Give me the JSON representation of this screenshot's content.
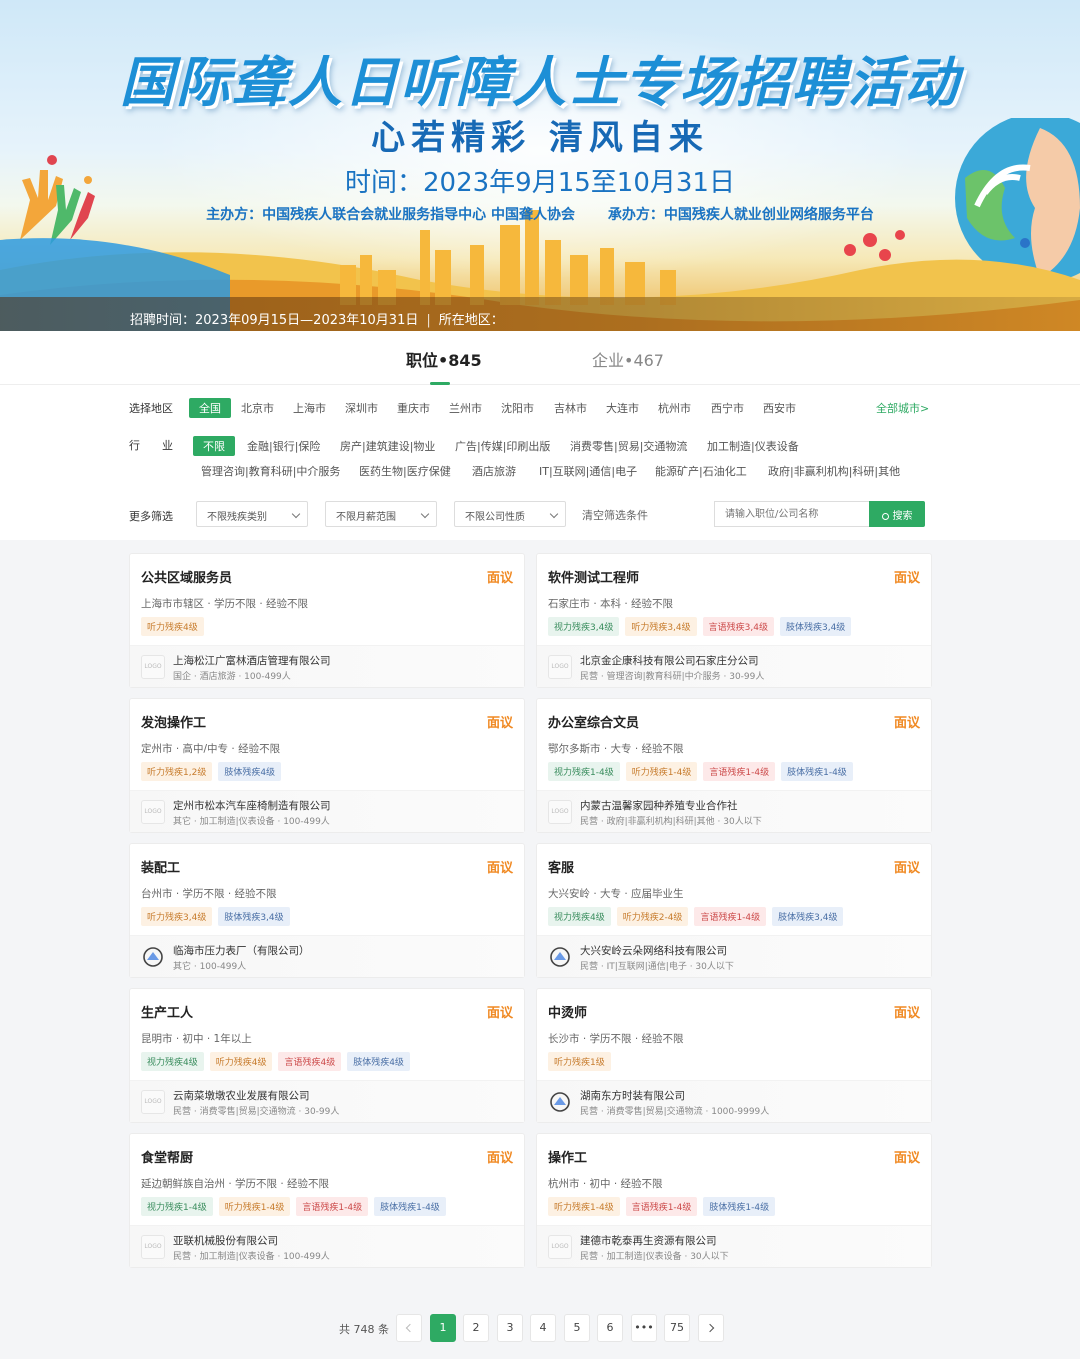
{
  "banner": {
    "title": "国际聋人日听障人士专场招聘活动",
    "slogan": "心若精彩   清风自来",
    "time": "时间：2023年9月15至10月31日",
    "organizer": "主办方：中国残疾人联合会就业服务指导中心  中国聋人协会",
    "undertaker": "承办方：中国残疾人就业创业网络服务平台",
    "recruit_time": "招聘时间：2023年09月15日—2023年10月31日",
    "region_label": "所在地区："
  },
  "tabs": [
    {
      "label": "职位•845"
    },
    {
      "label": "企业•467"
    }
  ],
  "filters": {
    "region_label": "选择地区",
    "regions": [
      "全国",
      "北京市",
      "上海市",
      "深圳市",
      "重庆市",
      "兰州市",
      "沈阳市",
      "吉林市",
      "大连市",
      "杭州市",
      "西宁市",
      "西安市"
    ],
    "all_cities": "全部城市>",
    "industry_label": "行　　业",
    "industries_row1": [
      "不限",
      "金融|银行|保险",
      "房产|建筑建设|物业",
      "广告|传媒|印刷出版",
      "消费零售|贸易|交通物流",
      "加工制造|仪表设备"
    ],
    "industries_row2": [
      "管理咨询|教育科研|中介服务",
      "医药生物|医疗保健",
      "酒店旅游",
      "IT|互联网|通信|电子",
      "能源矿产|石油化工",
      "政府|非赢利机构|科研|其他"
    ],
    "more_label": "更多筛选",
    "select_disability": "不限残疾类别",
    "select_salary": "不限月薪范围",
    "select_company": "不限公司性质",
    "clear": "清空筛选条件",
    "search_placeholder": "请输入职位/公司名称",
    "search_button": "搜索"
  },
  "jobs": [
    {
      "title": "公共区域服务员",
      "salary": "面议",
      "meta": "上海市市辖区 · 学历不限 · 经验不限",
      "tags": [
        {
          "type": "hearing",
          "text": "听力残疾4级"
        }
      ],
      "company": "上海松江广富林酒店管理有限公司",
      "company_info": "国企 · 酒店旅游 · 100-499人",
      "logo": "LOGO"
    },
    {
      "title": "软件测试工程师",
      "salary": "面议",
      "meta": "石家庄市 · 本科 · 经验不限",
      "tags": [
        {
          "type": "vision",
          "text": "视力残疾3,4级"
        },
        {
          "type": "hearing",
          "text": "听力残疾3,4级"
        },
        {
          "type": "speech",
          "text": "言语残疾3,4级"
        },
        {
          "type": "limb",
          "text": "肢体残疾3,4级"
        }
      ],
      "company": "北京金企康科技有限公司石家庄分公司",
      "company_info": "民营 · 管理咨询|教育科研|中介服务 · 30-99人",
      "logo": "LOGO"
    },
    {
      "title": "发泡操作工",
      "salary": "面议",
      "meta": "定州市 · 高中/中专 · 经验不限",
      "tags": [
        {
          "type": "hearing",
          "text": "听力残疾1,2级"
        },
        {
          "type": "limb",
          "text": "肢体残疾4级"
        }
      ],
      "company": "定州市松本汽车座椅制造有限公司",
      "company_info": "其它 · 加工制造|仪表设备 · 100-499人",
      "logo": "LOGO"
    },
    {
      "title": "办公室综合文员",
      "salary": "面议",
      "meta": "鄂尔多斯市 · 大专 · 经验不限",
      "tags": [
        {
          "type": "vision",
          "text": "视力残疾1-4级"
        },
        {
          "type": "hearing",
          "text": "听力残疾1-4级"
        },
        {
          "type": "speech",
          "text": "言语残疾1-4级"
        },
        {
          "type": "limb",
          "text": "肢体残疾1-4级"
        }
      ],
      "company": "内蒙古温馨家园种养殖专业合作社",
      "company_info": "民营 · 政府|非赢利机构|科研|其他 · 30人以下",
      "logo": "LOGO"
    },
    {
      "title": "装配工",
      "salary": "面议",
      "meta": "台州市 · 学历不限 · 经验不限",
      "tags": [
        {
          "type": "hearing",
          "text": "听力残疾3,4级"
        },
        {
          "type": "limb",
          "text": "肢体残疾3,4级"
        }
      ],
      "company": "临海市压力表厂（有限公司）",
      "company_info": "其它 · 100-499人",
      "logo": ""
    },
    {
      "title": "客服",
      "salary": "面议",
      "meta": "大兴安岭 · 大专 · 应届毕业生",
      "tags": [
        {
          "type": "vision",
          "text": "视力残疾4级"
        },
        {
          "type": "hearing",
          "text": "听力残疾2-4级"
        },
        {
          "type": "speech",
          "text": "言语残疾1-4级"
        },
        {
          "type": "limb",
          "text": "肢体残疾3,4级"
        }
      ],
      "company": "大兴安岭云朵网络科技有限公司",
      "company_info": "民营 · IT|互联网|通信|电子 · 30人以下",
      "logo": ""
    },
    {
      "title": "生产工人",
      "salary": "面议",
      "meta": "昆明市 · 初中 · 1年以上",
      "tags": [
        {
          "type": "vision",
          "text": "视力残疾4级"
        },
        {
          "type": "hearing",
          "text": "听力残疾4级"
        },
        {
          "type": "speech",
          "text": "言语残疾4级"
        },
        {
          "type": "limb",
          "text": "肢体残疾4级"
        }
      ],
      "company": "云南菜墩墩农业发展有限公司",
      "company_info": "民营 · 消费零售|贸易|交通物流 · 30-99人",
      "logo": "LOGO"
    },
    {
      "title": "中烫师",
      "salary": "面议",
      "meta": "长沙市 · 学历不限 · 经验不限",
      "tags": [
        {
          "type": "hearing",
          "text": "听力残疾1级"
        }
      ],
      "company": "湖南东方时装有限公司",
      "company_info": "民营 · 消费零售|贸易|交通物流 · 1000-9999人",
      "logo": ""
    },
    {
      "title": "食堂帮厨",
      "salary": "面议",
      "meta": "延边朝鲜族自治州 · 学历不限 · 经验不限",
      "tags": [
        {
          "type": "vision",
          "text": "视力残疾1-4级"
        },
        {
          "type": "hearing",
          "text": "听力残疾1-4级"
        },
        {
          "type": "speech",
          "text": "言语残疾1-4级"
        },
        {
          "type": "limb",
          "text": "肢体残疾1-4级"
        }
      ],
      "company": "亚联机械股份有限公司",
      "company_info": "民营 · 加工制造|仪表设备 · 100-499人",
      "logo": "LOGO"
    },
    {
      "title": "操作工",
      "salary": "面议",
      "meta": "杭州市 · 初中 · 经验不限",
      "tags": [
        {
          "type": "hearing",
          "text": "听力残疾1-4级"
        },
        {
          "type": "speech",
          "text": "言语残疾1-4级"
        },
        {
          "type": "limb",
          "text": "肢体残疾1-4级"
        }
      ],
      "company": "建德市乾泰再生资源有限公司",
      "company_info": "民营 · 加工制造|仪表设备 · 30人以下",
      "logo": "LOGO"
    }
  ],
  "pagination": {
    "total": "共 748 条",
    "pages": [
      "1",
      "2",
      "3",
      "4",
      "5",
      "6",
      "•••",
      "75"
    ],
    "current": "1"
  },
  "colors": {
    "accent": "#2eaa63",
    "salary": "#f08a24",
    "banner_title": "#1d8fd6"
  }
}
